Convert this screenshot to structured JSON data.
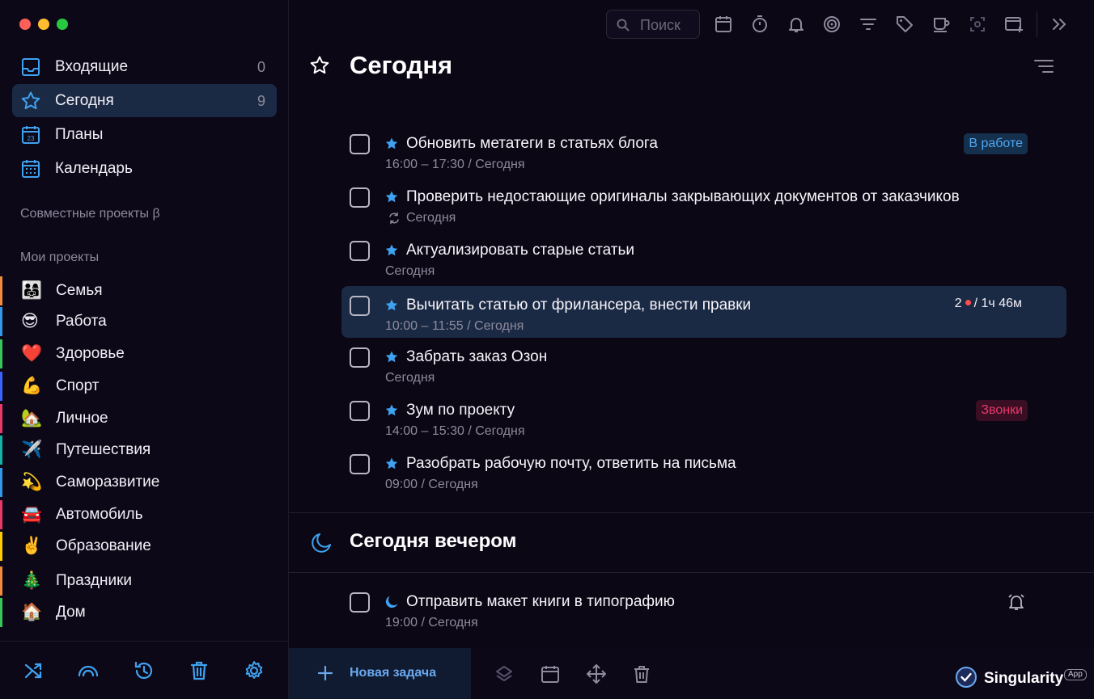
{
  "sidebar": {
    "nav": [
      {
        "label": "Входящие",
        "count": "0",
        "icon": "inbox-icon"
      },
      {
        "label": "Сегодня",
        "count": "9",
        "icon": "star-icon"
      },
      {
        "label": "Планы",
        "icon": "calendar-23-icon"
      },
      {
        "label": "Календарь",
        "icon": "calendar-grid-icon"
      }
    ],
    "shared_title": "Совместные проекты β",
    "projects_title": "Мои проекты",
    "projects": [
      {
        "emoji": "👨‍👩‍👧",
        "label": "Семья",
        "color": "#f28c3b"
      },
      {
        "emoji": "😎",
        "label": "Работа",
        "color": "#2f9be8"
      },
      {
        "emoji": "❤️",
        "label": "Здоровье",
        "color": "#34c759"
      },
      {
        "emoji": "💪",
        "label": "Спорт",
        "color": "#3a64ff"
      },
      {
        "emoji": "🏡",
        "label": "Личное",
        "color": "#e8386b"
      },
      {
        "emoji": "✈️",
        "label": "Путешествия",
        "color": "#13b4a8"
      },
      {
        "emoji": "💫",
        "label": "Саморазвитие",
        "color": "#2f9be8"
      },
      {
        "emoji": "🚘",
        "label": "Автомобиль",
        "color": "#e8386b"
      },
      {
        "emoji": "✌️",
        "label": "Образование",
        "color": "#ffcc00"
      },
      {
        "emoji": "🎄",
        "label": "Праздники",
        "color": "#f28c3b"
      },
      {
        "emoji": "🏠",
        "label": "Дом",
        "color": "#34c759"
      }
    ],
    "footer_icons": [
      "shuffle-icon",
      "rainbow-icon",
      "history-icon",
      "trash-icon",
      "settings-icon"
    ]
  },
  "toolbar": {
    "search_placeholder": "Поиск",
    "icons": [
      "calendar-icon",
      "timer-icon",
      "bell-icon",
      "focus-icon",
      "filter-icon",
      "tag-icon",
      "coffee-icon",
      "screenshot-icon",
      "new-window-icon",
      "expand-icon"
    ]
  },
  "page": {
    "title": "Сегодня",
    "tasks": [
      {
        "title": "Обновить метатеги в статьях блога",
        "meta": "16:00 – 17:30 / Сегодня",
        "badge": "В работе",
        "badge_color": "blue"
      },
      {
        "title": "Проверить недостающие оригиналы закрывающих документов от заказчиков",
        "meta": "Сегодня",
        "repeat": true
      },
      {
        "title": "Актуализировать старые статьи",
        "meta": "Сегодня"
      },
      {
        "title": "Вычитать статью от фрилансера, внести правки",
        "meta": "10:00 – 11:55 / Сегодня",
        "selected": true,
        "count": "2",
        "duration": "/ 1ч 46м"
      },
      {
        "title": "Забрать заказ Озон",
        "meta": "Сегодня"
      },
      {
        "title": "Зум по проекту",
        "meta": "14:00 – 15:30 / Сегодня",
        "badge": "Звонки",
        "badge_color": "red"
      },
      {
        "title": "Разобрать рабочую почту, ответить на письма",
        "meta": "09:00 / Сегодня"
      }
    ],
    "evening": {
      "title": "Сегодня вечером",
      "tasks": [
        {
          "title": "Отправить макет книги в типографию",
          "meta": "19:00 / Сегодня",
          "alarm": true
        }
      ]
    }
  },
  "bottombar": {
    "new_task_label": "Новая задача",
    "icons": [
      "layers-icon",
      "calendar-icon",
      "move-icon",
      "trash-icon"
    ],
    "brand": "Singularity",
    "brand_badge": "App"
  },
  "colors": {
    "accent": "#2f9be8",
    "selected_bg": "#1b2a44",
    "badge_blue": "#4ea7f2",
    "badge_red": "#e8386b"
  }
}
